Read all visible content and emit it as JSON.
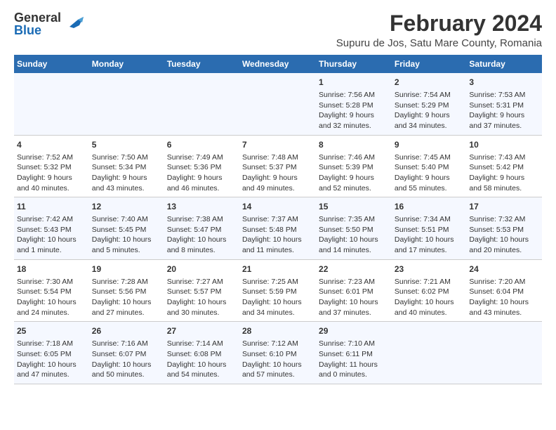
{
  "logo": {
    "general": "General",
    "blue": "Blue",
    "bird_icon": "▶"
  },
  "title": "February 2024",
  "location": "Supuru de Jos, Satu Mare County, Romania",
  "days_of_week": [
    "Sunday",
    "Monday",
    "Tuesday",
    "Wednesday",
    "Thursday",
    "Friday",
    "Saturday"
  ],
  "weeks": [
    [
      {
        "day": "",
        "info": ""
      },
      {
        "day": "",
        "info": ""
      },
      {
        "day": "",
        "info": ""
      },
      {
        "day": "",
        "info": ""
      },
      {
        "day": "1",
        "info": "Sunrise: 7:56 AM\nSunset: 5:28 PM\nDaylight: 9 hours\nand 32 minutes."
      },
      {
        "day": "2",
        "info": "Sunrise: 7:54 AM\nSunset: 5:29 PM\nDaylight: 9 hours\nand 34 minutes."
      },
      {
        "day": "3",
        "info": "Sunrise: 7:53 AM\nSunset: 5:31 PM\nDaylight: 9 hours\nand 37 minutes."
      }
    ],
    [
      {
        "day": "4",
        "info": "Sunrise: 7:52 AM\nSunset: 5:32 PM\nDaylight: 9 hours\nand 40 minutes."
      },
      {
        "day": "5",
        "info": "Sunrise: 7:50 AM\nSunset: 5:34 PM\nDaylight: 9 hours\nand 43 minutes."
      },
      {
        "day": "6",
        "info": "Sunrise: 7:49 AM\nSunset: 5:36 PM\nDaylight: 9 hours\nand 46 minutes."
      },
      {
        "day": "7",
        "info": "Sunrise: 7:48 AM\nSunset: 5:37 PM\nDaylight: 9 hours\nand 49 minutes."
      },
      {
        "day": "8",
        "info": "Sunrise: 7:46 AM\nSunset: 5:39 PM\nDaylight: 9 hours\nand 52 minutes."
      },
      {
        "day": "9",
        "info": "Sunrise: 7:45 AM\nSunset: 5:40 PM\nDaylight: 9 hours\nand 55 minutes."
      },
      {
        "day": "10",
        "info": "Sunrise: 7:43 AM\nSunset: 5:42 PM\nDaylight: 9 hours\nand 58 minutes."
      }
    ],
    [
      {
        "day": "11",
        "info": "Sunrise: 7:42 AM\nSunset: 5:43 PM\nDaylight: 10 hours\nand 1 minute."
      },
      {
        "day": "12",
        "info": "Sunrise: 7:40 AM\nSunset: 5:45 PM\nDaylight: 10 hours\nand 5 minutes."
      },
      {
        "day": "13",
        "info": "Sunrise: 7:38 AM\nSunset: 5:47 PM\nDaylight: 10 hours\nand 8 minutes."
      },
      {
        "day": "14",
        "info": "Sunrise: 7:37 AM\nSunset: 5:48 PM\nDaylight: 10 hours\nand 11 minutes."
      },
      {
        "day": "15",
        "info": "Sunrise: 7:35 AM\nSunset: 5:50 PM\nDaylight: 10 hours\nand 14 minutes."
      },
      {
        "day": "16",
        "info": "Sunrise: 7:34 AM\nSunset: 5:51 PM\nDaylight: 10 hours\nand 17 minutes."
      },
      {
        "day": "17",
        "info": "Sunrise: 7:32 AM\nSunset: 5:53 PM\nDaylight: 10 hours\nand 20 minutes."
      }
    ],
    [
      {
        "day": "18",
        "info": "Sunrise: 7:30 AM\nSunset: 5:54 PM\nDaylight: 10 hours\nand 24 minutes."
      },
      {
        "day": "19",
        "info": "Sunrise: 7:28 AM\nSunset: 5:56 PM\nDaylight: 10 hours\nand 27 minutes."
      },
      {
        "day": "20",
        "info": "Sunrise: 7:27 AM\nSunset: 5:57 PM\nDaylight: 10 hours\nand 30 minutes."
      },
      {
        "day": "21",
        "info": "Sunrise: 7:25 AM\nSunset: 5:59 PM\nDaylight: 10 hours\nand 34 minutes."
      },
      {
        "day": "22",
        "info": "Sunrise: 7:23 AM\nSunset: 6:01 PM\nDaylight: 10 hours\nand 37 minutes."
      },
      {
        "day": "23",
        "info": "Sunrise: 7:21 AM\nSunset: 6:02 PM\nDaylight: 10 hours\nand 40 minutes."
      },
      {
        "day": "24",
        "info": "Sunrise: 7:20 AM\nSunset: 6:04 PM\nDaylight: 10 hours\nand 43 minutes."
      }
    ],
    [
      {
        "day": "25",
        "info": "Sunrise: 7:18 AM\nSunset: 6:05 PM\nDaylight: 10 hours\nand 47 minutes."
      },
      {
        "day": "26",
        "info": "Sunrise: 7:16 AM\nSunset: 6:07 PM\nDaylight: 10 hours\nand 50 minutes."
      },
      {
        "day": "27",
        "info": "Sunrise: 7:14 AM\nSunset: 6:08 PM\nDaylight: 10 hours\nand 54 minutes."
      },
      {
        "day": "28",
        "info": "Sunrise: 7:12 AM\nSunset: 6:10 PM\nDaylight: 10 hours\nand 57 minutes."
      },
      {
        "day": "29",
        "info": "Sunrise: 7:10 AM\nSunset: 6:11 PM\nDaylight: 11 hours\nand 0 minutes."
      },
      {
        "day": "",
        "info": ""
      },
      {
        "day": "",
        "info": ""
      }
    ]
  ]
}
